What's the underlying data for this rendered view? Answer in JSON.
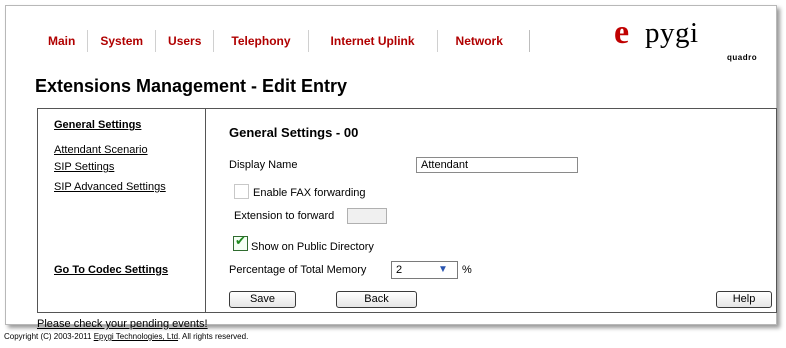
{
  "menu": [
    "Main",
    "System",
    "Users",
    "Telephony",
    "Internet Uplink",
    "Network"
  ],
  "logo": {
    "mark": "e",
    "text": "pygi",
    "sub": "quadro"
  },
  "page_title": "Extensions Management - Edit Entry",
  "left_nav": {
    "general": "General Settings",
    "attendant": "Attendant Scenario",
    "sip": "SIP Settings",
    "sip_advanced": "SIP Advanced Settings",
    "codec": "Go To Codec Settings"
  },
  "form": {
    "section_title": "General Settings - 00",
    "display_name_label": "Display Name",
    "display_name_value": "Attendant",
    "fax_label": "Enable FAX forwarding",
    "fax_checked": false,
    "ext_forward_label": "Extension to forward",
    "ext_forward_value": "",
    "public_dir_label": "Show on Public Directory",
    "public_dir_checked": true,
    "memory_label": "Percentage of Total Memory",
    "memory_value": "2",
    "memory_unit": "%"
  },
  "buttons": {
    "save": "Save",
    "back": "Back",
    "help": "Help"
  },
  "footer": {
    "pending": "Please check your pending events!",
    "copyright_prefix": "Copyright (C) 2003-2011 ",
    "company": "Epygi Technologies, Ltd",
    "copyright_suffix": ". All rights reserved."
  }
}
